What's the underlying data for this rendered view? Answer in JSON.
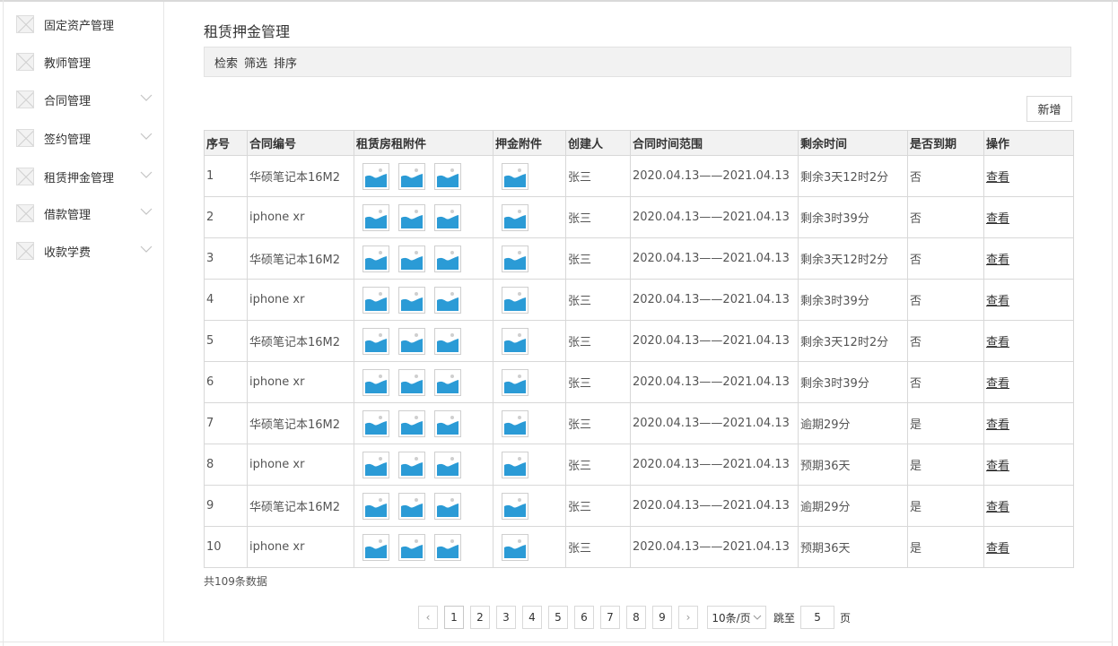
{
  "sidebar": {
    "items": [
      {
        "label": "固定资产管理",
        "chevron": false
      },
      {
        "label": "教师管理",
        "chevron": false
      },
      {
        "label": "合同管理",
        "chevron": true
      },
      {
        "label": "签约管理",
        "chevron": true
      },
      {
        "label": "租赁押金管理",
        "chevron": true
      },
      {
        "label": "借款管理",
        "chevron": true
      },
      {
        "label": "收款学费",
        "chevron": true
      }
    ]
  },
  "main": {
    "title": "租赁押金管理",
    "filters": [
      "检索",
      "筛选",
      "排序"
    ],
    "add_label": "新增"
  },
  "table": {
    "columns": [
      "序号",
      "合同编号",
      "租赁房租附件",
      "押金附件",
      "创建人",
      "合同时间范围",
      "剩余时间",
      "是否到期",
      "操作"
    ],
    "rows": [
      {
        "no": "1",
        "contract": "华硕笔记本16M2",
        "creator": "张三",
        "range": "2020.04.13——2021.04.13",
        "remaining": "剩余3天12时2分",
        "expired": "否",
        "action": "查看"
      },
      {
        "no": "2",
        "contract": "iphone xr",
        "creator": "张三",
        "range": "2020.04.13——2021.04.13",
        "remaining": "剩余3时39分",
        "expired": "否",
        "action": "查看"
      },
      {
        "no": "3",
        "contract": "华硕笔记本16M2",
        "creator": "张三",
        "range": "2020.04.13——2021.04.13",
        "remaining": "剩余3天12时2分",
        "expired": "否",
        "action": "查看"
      },
      {
        "no": "4",
        "contract": "iphone xr",
        "creator": "张三",
        "range": "2020.04.13——2021.04.13",
        "remaining": "剩余3时39分",
        "expired": "否",
        "action": "查看"
      },
      {
        "no": "5",
        "contract": "华硕笔记本16M2",
        "creator": "张三",
        "range": "2020.04.13——2021.04.13",
        "remaining": "剩余3天12时2分",
        "expired": "否",
        "action": "查看"
      },
      {
        "no": "6",
        "contract": "iphone xr",
        "creator": "张三",
        "range": "2020.04.13——2021.04.13",
        "remaining": "剩余3时39分",
        "expired": "否",
        "action": "查看"
      },
      {
        "no": "7",
        "contract": "华硕笔记本16M2",
        "creator": "张三",
        "range": "2020.04.13——2021.04.13",
        "remaining": "逾期29分",
        "expired": "是",
        "action": "查看"
      },
      {
        "no": "8",
        "contract": "iphone xr",
        "creator": "张三",
        "range": "2020.04.13——2021.04.13",
        "remaining": "预期36天",
        "expired": "是",
        "action": "查看"
      },
      {
        "no": "9",
        "contract": "华硕笔记本16M2",
        "creator": "张三",
        "range": "2020.04.13——2021.04.13",
        "remaining": "逾期29分",
        "expired": "是",
        "action": "查看"
      },
      {
        "no": "10",
        "contract": "iphone xr",
        "creator": "张三",
        "range": "2020.04.13——2021.04.13",
        "remaining": "预期36天",
        "expired": "是",
        "action": "查看"
      }
    ]
  },
  "footer": {
    "total": "共109条数据",
    "prev": "‹",
    "next": "›",
    "pages": [
      "1",
      "2",
      "3",
      "4",
      "5",
      "6",
      "7",
      "8",
      "9"
    ],
    "current_page": "1",
    "page_size": "10条/页",
    "jump_label": "跳至",
    "jump_value": "5",
    "page_unit": "页"
  },
  "icons": {
    "attachment": "image-icon",
    "placeholder": "broken-image-icon",
    "expand": "chevron-down-icon"
  },
  "colors": {
    "image_sky": "#2b9bd6",
    "header_bg": "#f2f2f2"
  }
}
